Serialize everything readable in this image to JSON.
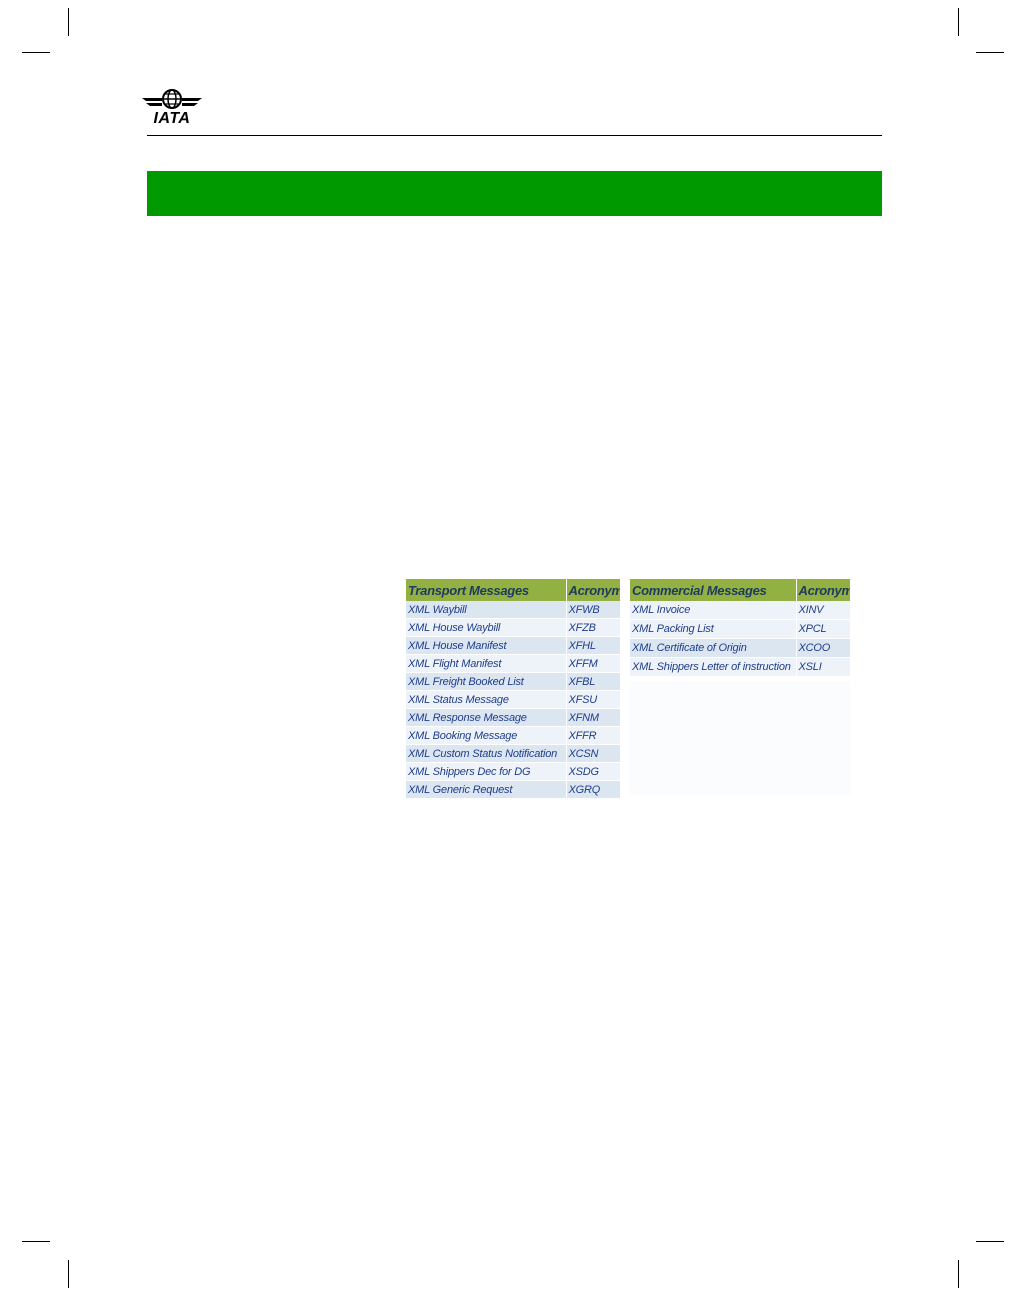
{
  "header": {
    "logo_text": "IATA",
    "accent_color": "#009a00"
  },
  "transport_table": {
    "headers": [
      "Transport Messages",
      "Acronym"
    ],
    "rows": [
      {
        "name": "XML Waybill",
        "acronym": "XFWB"
      },
      {
        "name": "XML House Waybill",
        "acronym": "XFZB"
      },
      {
        "name": "XML House Manifest",
        "acronym": "XFHL"
      },
      {
        "name": "XML Flight Manifest",
        "acronym": "XFFM"
      },
      {
        "name": "XML Freight Booked List",
        "acronym": "XFBL"
      },
      {
        "name": "XML Status Message",
        "acronym": "XFSU"
      },
      {
        "name": "XML Response Message",
        "acronym": "XFNM"
      },
      {
        "name": "XML Booking Message",
        "acronym": "XFFR"
      },
      {
        "name": "XML Custom Status Notification",
        "acronym": "XCSN"
      },
      {
        "name": "XML Shippers Dec for DG",
        "acronym": "XSDG"
      },
      {
        "name": "XML Generic Request",
        "acronym": "XGRQ"
      }
    ]
  },
  "commercial_table": {
    "headers": [
      "Commercial Messages",
      "Acronym"
    ],
    "rows": [
      {
        "name": "XML Invoice",
        "acronym": "XINV"
      },
      {
        "name": "XML Packing List",
        "acronym": "XPCL"
      },
      {
        "name": "XML Certificate of Origin",
        "acronym": "XCOO"
      },
      {
        "name": "XML Shippers Letter of instruction",
        "acronym": "XSLI"
      }
    ]
  }
}
